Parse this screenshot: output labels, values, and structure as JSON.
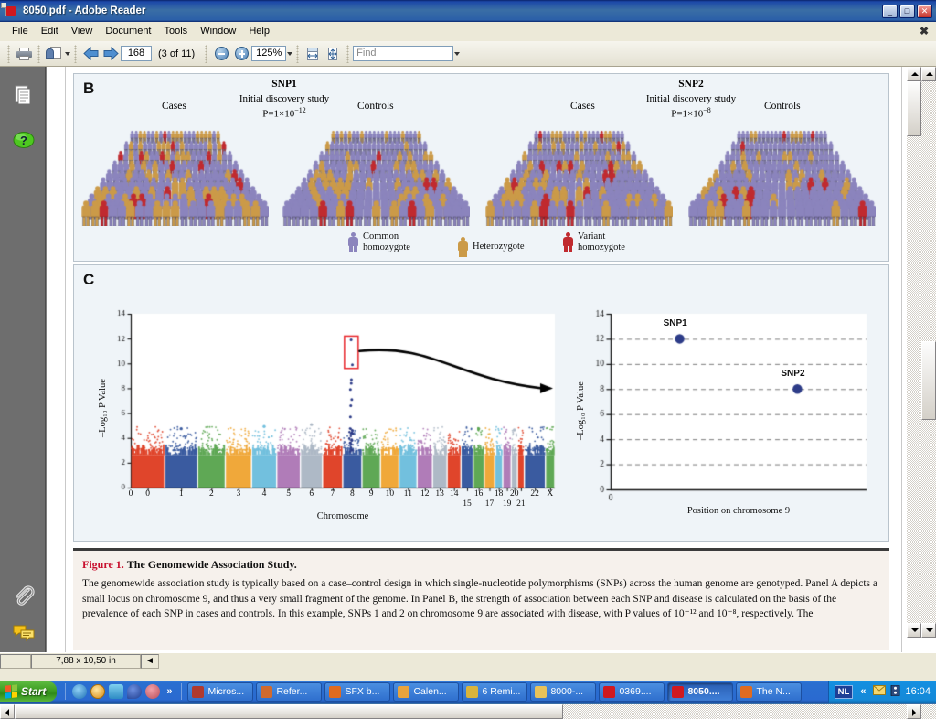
{
  "window": {
    "title": "8050.pdf - Adobe Reader",
    "app_icon": "pdf-document-icon",
    "minimize": "_",
    "maximize": "□",
    "close": "✕",
    "doc_close": "✖"
  },
  "menubar": {
    "items": [
      "File",
      "Edit",
      "View",
      "Document",
      "Tools",
      "Window",
      "Help"
    ]
  },
  "toolbar": {
    "print_icon": "print-icon",
    "email_icon": "email-document-icon",
    "prev_icon": "previous-page-arrow-icon",
    "next_icon": "next-page-arrow-icon",
    "page_number": "168",
    "page_of": "(3 of 11)",
    "zoom_out_icon": "zoom-out-icon",
    "zoom_in_icon": "zoom-in-icon",
    "zoom_value": "125%",
    "fit_width_icon": "fit-width-icon",
    "fit_page_icon": "fit-page-icon",
    "find_placeholder": "Find"
  },
  "navpane": {
    "items": [
      {
        "name": "pages-panel-icon",
        "label": "Pages"
      },
      {
        "name": "help-question-icon",
        "label": "How To"
      },
      {
        "name": "attachments-paperclip-icon",
        "label": "Attachments"
      },
      {
        "name": "comments-icon",
        "label": "Comments"
      }
    ]
  },
  "document": {
    "panelB": {
      "letter": "B",
      "snp1": {
        "title": "SNP1",
        "subtitle_line1": "Initial discovery study",
        "subtitle_line2": "P=1×10",
        "subtitle_exp": "−12",
        "cases": "Cases",
        "controls": "Controls"
      },
      "snp2": {
        "title": "SNP2",
        "subtitle_line1": "Initial discovery study",
        "subtitle_line2": "P=1×10",
        "subtitle_exp": "−8",
        "cases": "Cases",
        "controls": "Controls"
      },
      "legend": [
        {
          "label_line1": "Common",
          "label_line2": "homozygote",
          "color": "#8b84bd",
          "name": "legend-common-homozygote"
        },
        {
          "label_line1": "Heterozygote",
          "label_line2": "",
          "color": "#cb9a48",
          "name": "legend-heterozygote"
        },
        {
          "label_line1": "Variant",
          "label_line2": "homozygote",
          "color": "#c02a2f",
          "name": "legend-variant-homozygote"
        }
      ]
    },
    "panelC": {
      "letter": "C"
    },
    "caption": {
      "figure_label": "Figure 1.",
      "figure_title": "The Genomewide Association Study.",
      "body": "The genomewide association study is typically based on a case–control design in which single-nucleotide polymorphisms (SNPs) across the human genome are genotyped. Panel A depicts a small locus on chromosome 9, and thus a very small fragment of the genome. In Panel B, the strength of association between each SNP and disease is calculated on the basis of the prevalence of each SNP in cases and controls. In this example, SNPs 1 and 2 on chromosome 9 are associated with disease, with P values of 10⁻¹² and 10⁻⁸, respectively. The"
    }
  },
  "chart_data": [
    {
      "type": "scatter",
      "name": "manhattan-plot",
      "title": "",
      "xlabel": "Chromosome",
      "ylabel": "–Log₁₀ P Value",
      "ylim": [
        0,
        14
      ],
      "yticks": [
        0,
        2,
        4,
        6,
        8,
        10,
        12,
        14
      ],
      "ytick_labels": [
        "0",
        "2",
        "4",
        "6",
        "8",
        "10",
        "12",
        "14"
      ],
      "xtick_labels": [
        "0",
        "1",
        "2",
        "3",
        "4",
        "5",
        "6",
        "7",
        "8",
        "9",
        "10",
        "11",
        "12",
        "13",
        "14",
        "15",
        "16",
        "17",
        "18",
        "19",
        "20",
        "21",
        "22",
        "X"
      ],
      "grid": false,
      "legend": "none",
      "highlight_box": {
        "label": "chromosome-9-highlight",
        "color": "#e8252a",
        "x_chrom": 9,
        "y_range": [
          9.6,
          12.2
        ]
      },
      "annotation_arrow": true,
      "chromosome_colors": [
        "#e0452b",
        "#3a5ba0",
        "#5fa855",
        "#f0a83a",
        "#72c0de",
        "#b07cb8",
        "#aeb9c6",
        "#e0452b",
        "#3a5ba0",
        "#5fa855",
        "#f0a83a",
        "#72c0de",
        "#b07cb8",
        "#aeb9c6",
        "#e0452b",
        "#3a5ba0",
        "#5fa855",
        "#f0a83a",
        "#72c0de",
        "#b07cb8",
        "#aeb9c6",
        "#e0452b",
        "#3a5ba0",
        "#5fa855"
      ],
      "peak_points": [
        {
          "chrom": 9,
          "value": 11.9
        },
        {
          "chrom": 9,
          "value": 9.9
        },
        {
          "chrom": 9,
          "value": 8.7
        },
        {
          "chrom": 9,
          "value": 8.4
        },
        {
          "chrom": 9,
          "value": 7.9
        },
        {
          "chrom": 9,
          "value": 7.1
        },
        {
          "chrom": 9,
          "value": 6.6
        },
        {
          "chrom": 9,
          "value": 5.7
        },
        {
          "chrom": 9,
          "value": 4.6
        }
      ],
      "baseline_top": 2.6
    },
    {
      "type": "scatter",
      "name": "chromosome9-zoom-plot",
      "title": "",
      "xlabel": "Position on chromosome 9",
      "ylabel": "–Log₁₀ P Value",
      "ylim": [
        0,
        14
      ],
      "yticks": [
        0,
        2,
        4,
        6,
        8,
        10,
        12,
        14
      ],
      "ytick_labels": [
        "0",
        "2",
        "4",
        "6",
        "8",
        "10",
        "12",
        "14"
      ],
      "xticks": [
        0
      ],
      "xtick_labels": [
        "0"
      ],
      "grid": true,
      "grid_style": "dashed-horizontal",
      "legend": "none",
      "point_color": "#2d3c88",
      "points": [
        {
          "label": "SNP1",
          "x": 0.27,
          "y": 12
        },
        {
          "label": "SNP2",
          "x": 0.73,
          "y": 8
        }
      ]
    }
  ],
  "statusbar": {
    "page_size": "7,88 x 10,50 in",
    "nav_arrow": "◄"
  },
  "taskbar": {
    "start_label": "Start",
    "quicklaunch": [
      {
        "name": "internet-explorer-icon",
        "color": "#2e7ec1"
      },
      {
        "name": "clock-icon",
        "color": "#e8a33d"
      },
      {
        "name": "outlook-express-icon",
        "color": "#4aa6d8"
      },
      {
        "name": "messenger-icon",
        "color": "#2b4f9e"
      },
      {
        "name": "network-icon",
        "color": "#d26a74"
      }
    ],
    "overflow_chevron": "»",
    "tasks": [
      {
        "label": "Micros...",
        "icon_color": "#b03a2e",
        "active": false,
        "name": "task-microsoft"
      },
      {
        "label": "Refer...",
        "icon_color": "#d06a2e",
        "active": false,
        "name": "task-reference"
      },
      {
        "label": "SFX b...",
        "icon_color": "#e06b1f",
        "active": false,
        "name": "task-sfx"
      },
      {
        "label": "Calen...",
        "icon_color": "#e8a33d",
        "active": false,
        "name": "task-calendar"
      },
      {
        "label": "6 Remi...",
        "icon_color": "#d9b43c",
        "active": false,
        "name": "task-reminders"
      },
      {
        "label": "8000-...",
        "icon_color": "#e8c25a",
        "active": false,
        "name": "task-folder-8000"
      },
      {
        "label": "0369....",
        "icon_color": "#d0191f",
        "active": false,
        "name": "task-pdf-0369"
      },
      {
        "label": "8050....",
        "icon_color": "#d0191f",
        "active": true,
        "name": "task-pdf-8050"
      },
      {
        "label": "The N...",
        "icon_color": "#e06b1f",
        "active": false,
        "name": "task-firefox-nejm"
      }
    ],
    "tray": {
      "language": "NL",
      "show_hidden": "«",
      "mail_icon": "mail-icon",
      "volume_icon": "volume-icon",
      "clock": "16:04"
    }
  }
}
